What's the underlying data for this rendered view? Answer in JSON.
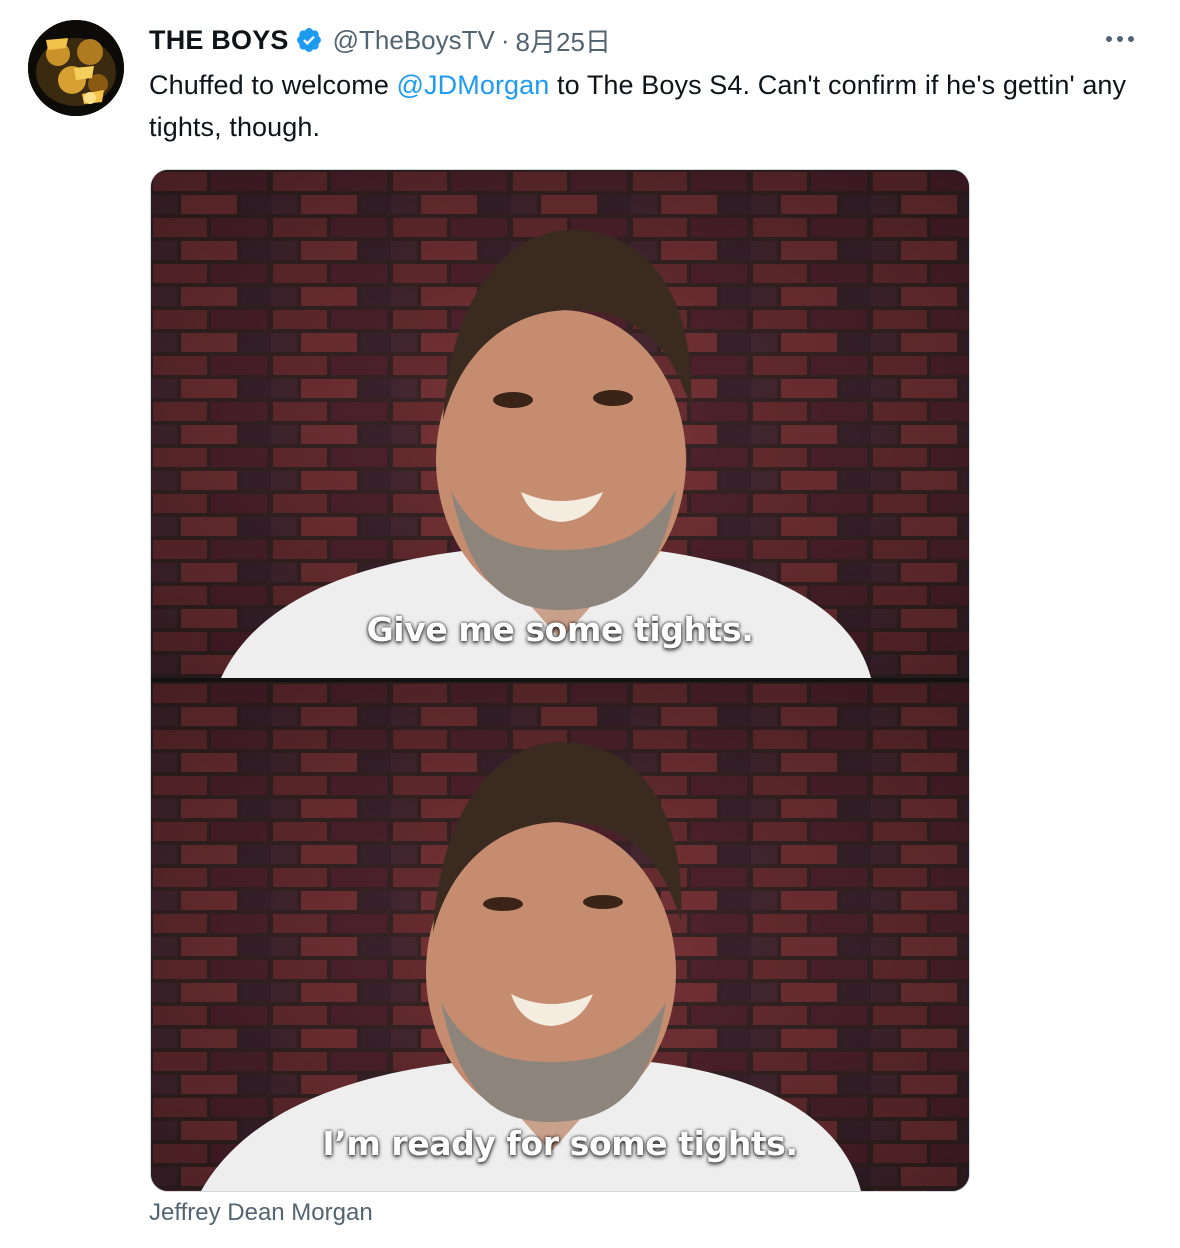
{
  "tweet": {
    "author": {
      "display_name": "THE BOYS",
      "verified": true,
      "handle": "@TheBoysTV",
      "avatar_icon": "the-boys-logo-avatar"
    },
    "separator": "·",
    "timestamp": "8月25日",
    "more_icon": "more-dots-icon",
    "text": {
      "before_mention": "Chuffed to welcome ",
      "mention": "@JDMorgan",
      "after_mention": " to The Boys S4. Can't confirm if he's gettin' any tights, though."
    },
    "media": {
      "frames": [
        {
          "subtitle": "Give me some tights."
        },
        {
          "subtitle": "I’m ready for some tights."
        }
      ]
    },
    "media_caption": "Jeffrey Dean Morgan"
  },
  "colors": {
    "link": "#1d9bf0",
    "verified": "#1d9bf0",
    "secondary_text": "#536471",
    "primary_text": "#0f1419"
  }
}
